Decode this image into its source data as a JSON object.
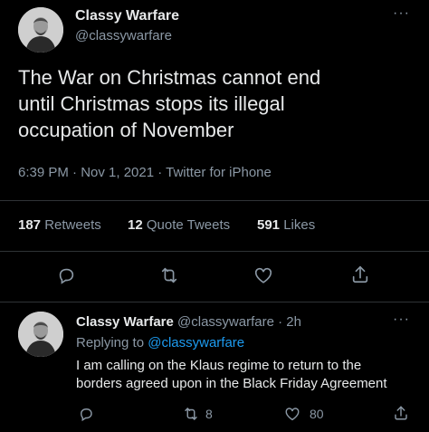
{
  "tweet": {
    "author_name": "Classy Warfare",
    "author_handle": "@classywarfare",
    "text_lines": [
      "The War on Christmas cannot end",
      "until Christmas stops its illegal",
      "occupation of November"
    ],
    "timestamp": "6:39 PM · Nov 1, 2021 · Twitter for iPhone",
    "stats": {
      "retweets_count": "187",
      "retweets_label": "Retweets",
      "quotes_count": "12",
      "quotes_label": "Quote Tweets",
      "likes_count": "591",
      "likes_label": "Likes"
    },
    "actions": [
      "reply-icon",
      "retweet-icon",
      "like-icon",
      "share-icon"
    ]
  },
  "reply": {
    "author_name": "Classy Warfare",
    "handle_time": "@classywarfare · 2h",
    "replying_prefix": "Replying to",
    "replying_to": "@classywarfare",
    "text_lines": [
      "I am calling on the Klaus regime to return to the",
      "borders agreed upon in the Black Friday Agreement"
    ],
    "retweet_count": "8",
    "like_count": "80"
  },
  "more_glyph": "···",
  "colors": {
    "background": "#000000",
    "text": "#e7e9ea",
    "secondary": "#8b98a5",
    "link": "#1d9bf0",
    "divider": "#2f3336"
  }
}
